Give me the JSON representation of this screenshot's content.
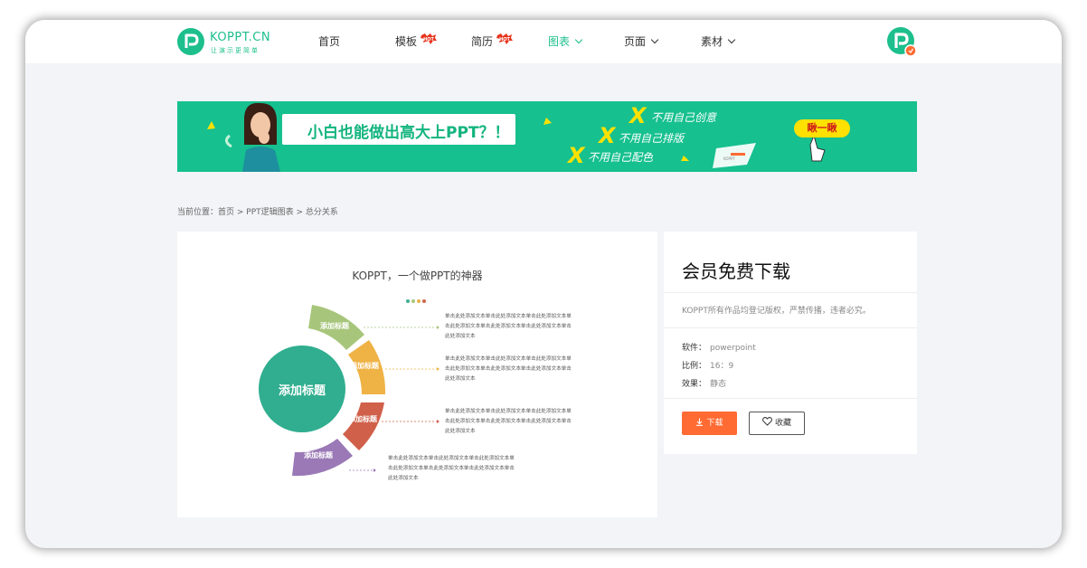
{
  "header": {
    "logo": {
      "name": "KOPPT.CN",
      "slogan": "让演示更简单"
    },
    "nav": [
      {
        "label": "首页",
        "hot": false,
        "dropdown": false,
        "active": false
      },
      {
        "label": "模板",
        "hot": true,
        "dropdown": false,
        "active": false
      },
      {
        "label": "简历",
        "hot": true,
        "dropdown": false,
        "active": false
      },
      {
        "label": "图表",
        "hot": false,
        "dropdown": true,
        "active": true
      },
      {
        "label": "页面",
        "hot": false,
        "dropdown": true,
        "active": false
      },
      {
        "label": "素材",
        "hot": false,
        "dropdown": true,
        "active": false
      }
    ],
    "hot_badge": "HOT"
  },
  "banner": {
    "headline": "小白也能做出高大上PPT？！",
    "items": [
      "不用自己创意",
      "不用自己排版",
      "不用自己配色"
    ],
    "x_mark": "X",
    "cta": "瞅一瞅",
    "paper_mark": "KOPPT"
  },
  "breadcrumb": {
    "prefix": "当前位置：",
    "path": "首页 > PPT逻辑图表 > 总分关系"
  },
  "preview": {
    "title": "KOPPT，一个做PPT的神器",
    "dot_colors": [
      "#3fae94",
      "#a7c67b",
      "#e8b14a",
      "#d06548"
    ],
    "center_label": "添加标题",
    "segments": [
      {
        "label": "添加标题",
        "color": "#a7c67b"
      },
      {
        "label": "添加标题",
        "color": "#efb244"
      },
      {
        "label": "添加标题",
        "color": "#d0604a"
      },
      {
        "label": "添加标题",
        "color": "#9a79b6"
      }
    ],
    "center_color": "#30ae8f",
    "text_blocks": [
      "单击此处添加文本单击此处添加文本单击此处添加文本单击此处添加文本单击此处添加文本单击此处添加文本单击此处添加文本",
      "单击此处添加文本单击此处添加文本单击此处添加文本单击此处添加文本单击此处添加文本单击此处添加文本单击此处添加文本",
      "单击此处添加文本单击此处添加文本单击此处添加文本单击此处添加文本单击此处添加文本单击此处添加文本单击此处添加文本",
      "单击此处添加文本单击此处添加文本单击此处添加文本单击此处添加文本单击此处添加文本单击此处添加文本单击此处添加文本"
    ]
  },
  "sidebar": {
    "title": "会员免费下载",
    "notice": "KOPPT所有作品均登记版权，严禁传播，违者必究。",
    "specs": [
      {
        "key": "软件：",
        "value": "powerpoint"
      },
      {
        "key": "比例：",
        "value": "16：9"
      },
      {
        "key": "效果：",
        "value": "静态"
      }
    ],
    "download_label": "下载",
    "favorite_label": "收藏"
  },
  "colors": {
    "brand": "#1dbf8c",
    "banner_bg": "#16c08f",
    "download": "#ff6b33",
    "page_bg": "#f3f4f7"
  }
}
